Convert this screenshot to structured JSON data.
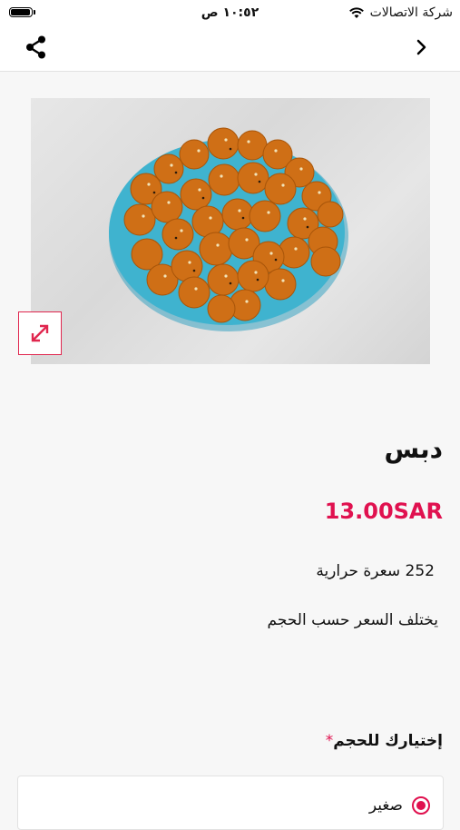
{
  "status_bar": {
    "carrier": "شركة الاتصالات",
    "time": "١٠:٥٢ ص"
  },
  "nav": {
    "share_icon": "share-icon",
    "back_icon": "chevron-right-icon"
  },
  "product": {
    "name": "دبس",
    "price": "13.00SAR",
    "calories": "252 سعرة حرارية",
    "note": "يختلف السعر حسب الحجم"
  },
  "size_section": {
    "label": "إختيارك للحجم",
    "required_mark": "*",
    "options": [
      {
        "label": "صغير",
        "selected": true
      }
    ]
  },
  "colors": {
    "accent": "#e0114f",
    "plate": "#3fb3cf",
    "food": "#d77a1f"
  }
}
